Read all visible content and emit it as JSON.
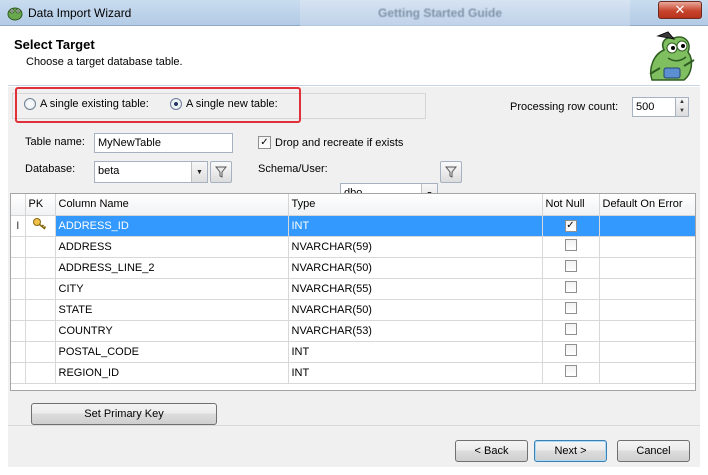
{
  "window": {
    "title": "Data Import Wizard",
    "close": "✕",
    "background_window_title": "Getting Started Guide"
  },
  "header": {
    "title": "Select Target",
    "subtitle": "Choose a target database table."
  },
  "target_mode": {
    "existing_label": "A single existing table:",
    "new_label": "A single new table:",
    "selected": "new"
  },
  "processing": {
    "label": "Processing row count:",
    "value": "500"
  },
  "form": {
    "table_name_label": "Table name:",
    "table_name_value": "MyNewTable",
    "database_label": "Database:",
    "database_value": "beta",
    "drop_recreate_label": "Drop and recreate if exists",
    "drop_recreate_checked": true,
    "schema_label": "Schema/User:",
    "schema_value": "dbo"
  },
  "grid": {
    "columns": [
      "PK",
      "Column Name",
      "Type",
      "Not Null",
      "Default On Error"
    ],
    "cursor_marker": "I",
    "rows": [
      {
        "name": "ADDRESS_ID",
        "type": "INT",
        "not_null": true,
        "pk": true,
        "selected": true
      },
      {
        "name": "ADDRESS",
        "type": "NVARCHAR(59)",
        "not_null": false,
        "pk": false
      },
      {
        "name": "ADDRESS_LINE_2",
        "type": "NVARCHAR(50)",
        "not_null": false,
        "pk": false
      },
      {
        "name": "CITY",
        "type": "NVARCHAR(55)",
        "not_null": false,
        "pk": false
      },
      {
        "name": "STATE",
        "type": "NVARCHAR(50)",
        "not_null": false,
        "pk": false
      },
      {
        "name": "COUNTRY",
        "type": "NVARCHAR(53)",
        "not_null": false,
        "pk": false
      },
      {
        "name": "POSTAL_CODE",
        "type": "INT",
        "not_null": false,
        "pk": false
      },
      {
        "name": "REGION_ID",
        "type": "INT",
        "not_null": false,
        "pk": false
      }
    ]
  },
  "buttons": {
    "set_primary_key": "Set Primary Key",
    "back": "< Back",
    "next": "Next >",
    "cancel": "Cancel"
  },
  "colors": {
    "selection": "#3399ff",
    "highlight_frame": "#e0303a"
  }
}
